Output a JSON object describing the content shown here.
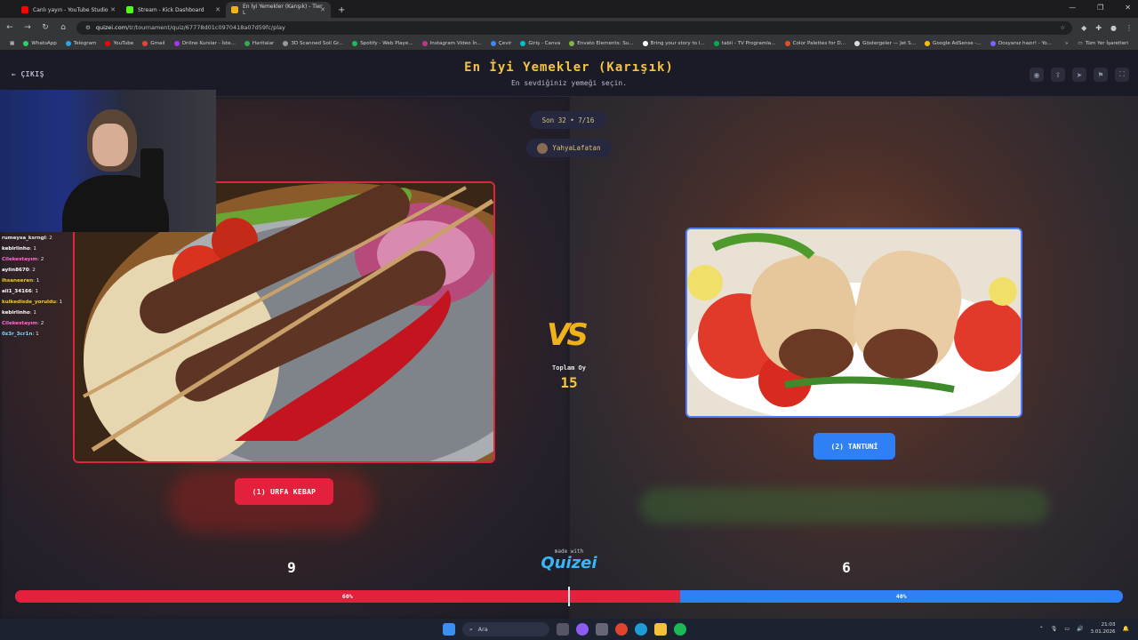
{
  "browser": {
    "tabs": [
      {
        "label": "Canlı yayın - YouTube Studio",
        "color": "#ff0000"
      },
      {
        "label": "Stream - Kick Dashboard",
        "color": "#53fc18"
      },
      {
        "label": "En İyi Yemekler (Karışık) - Tier L",
        "color": "#f0b21b",
        "active": true
      }
    ],
    "new_tab": "+",
    "url_host": "quizei.com",
    "url_path": "/tr/tournament/quiz/67778d01c0970418a07d59fc/play",
    "bookmarks": [
      {
        "label": "WhatsApp",
        "color": "#25d366"
      },
      {
        "label": "Telegram",
        "color": "#2aa3df"
      },
      {
        "label": "YouTube",
        "color": "#ff0000"
      },
      {
        "label": "Gmail",
        "color": "#ea4335"
      },
      {
        "label": "Online Kurslar - İste...",
        "color": "#a435f0"
      },
      {
        "label": "Haritalar",
        "color": "#34a853"
      },
      {
        "label": "3D Scanned Soil Gr...",
        "color": "#999999"
      },
      {
        "label": "Spotify - Web Playe...",
        "color": "#1db954"
      },
      {
        "label": "Instagram Video İn...",
        "color": "#c13584"
      },
      {
        "label": "Çevir",
        "color": "#4285f4"
      },
      {
        "label": "Giriş - Canva",
        "color": "#00c4cc"
      },
      {
        "label": "Envato Elements: Su...",
        "color": "#82b541"
      },
      {
        "label": "Bring your story to l...",
        "color": "#ffffff"
      },
      {
        "label": "tabii - TV Programla...",
        "color": "#00b050"
      },
      {
        "label": "Color Palettes for D...",
        "color": "#e34c26"
      },
      {
        "label": "Göstergeler — Jet S...",
        "color": "#dddddd"
      },
      {
        "label": "Google AdSense -...",
        "color": "#fbbc04"
      },
      {
        "label": "Dosyanız hazır! - Yo...",
        "color": "#7b61ff"
      }
    ],
    "all_bookmarks": "Tüm Yer İşaretleri"
  },
  "header": {
    "exit_label": "ÇIKIŞ",
    "title": "En İyi Yemekler (Karışık)",
    "subtitle": "En sevdiğiniz yemeği seçin."
  },
  "round": "Son 32 • 7/16",
  "creator": "YahyaLafatan",
  "vs": "VS",
  "total_votes_label": "Toplam Oy",
  "total_votes": "15",
  "left": {
    "button": "(1) URFA KEBAP",
    "votes": "9",
    "percent_label": "60%",
    "percent": 60
  },
  "right": {
    "button": "(2) TANTUNİ",
    "votes": "6",
    "percent_label": "40%",
    "percent": 40
  },
  "made_with": "made with",
  "brand": "Quizei",
  "chat": [
    {
      "user": "rumeysa_ksrngl",
      "text": ": 2",
      "color": "#e8e8e8"
    },
    {
      "user": "kebirlinho",
      "text": ": 1",
      "color": "#ffffff"
    },
    {
      "user": "Cilekestayım",
      "text": ": 2",
      "color": "#ff6bd5"
    },
    {
      "user": "aylin8670",
      "text": ": 2",
      "color": "#ffffff"
    },
    {
      "user": "ihsaneeren",
      "text": ": 1",
      "color": "#f5c542"
    },
    {
      "user": "ali1_34166",
      "text": ": 1",
      "color": "#ffffff"
    },
    {
      "user": "kulkedisde_yoruldu",
      "text": ": 1",
      "color": "#f5c542"
    },
    {
      "user": "kebirlinho",
      "text": ": 1",
      "color": "#ffffff"
    },
    {
      "user": "Cilekestayım",
      "text": ": 2",
      "color": "#ff6bd5"
    },
    {
      "user": "0z3r_3cr1n",
      "text": ": 1",
      "color": "#7fd7ff"
    }
  ],
  "taskbar": {
    "search": "Ara",
    "time": "21:03",
    "date": "3.01.2026"
  }
}
